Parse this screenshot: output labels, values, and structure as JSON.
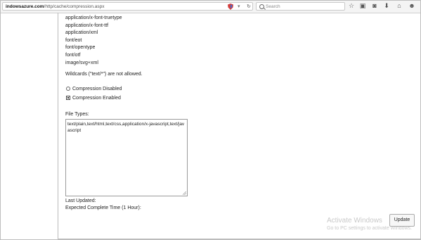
{
  "browser": {
    "url_host": "indowsazure.com",
    "url_path": "/http/cache/compression.aspx",
    "search_placeholder": "Search",
    "icons": [
      "shield-icon",
      "dropdown-arrow-icon",
      "reload-icon",
      "search-icon",
      "star-icon",
      "clipboard-icon",
      "pocket-icon",
      "download-icon",
      "home-icon",
      "menu-icon"
    ]
  },
  "mime_types": [
    "application/x-font-truetype",
    "application/x-font-ttf",
    "application/xml",
    "font/eot",
    "font/opentype",
    "font/otf",
    "image/svg+xml"
  ],
  "wildcards_note": "Wildcards (\"text/*\") are not allowed.",
  "compression": {
    "disabled_label": "Compression Disabled",
    "enabled_label": "Compression Enabled",
    "selected": "enabled"
  },
  "file_types": {
    "label": "File Types:",
    "value": "text/plain,text/html,text/css,application/x-javascript,text/javascript"
  },
  "last_updated_label": "Last Updated:",
  "expected_time_label": "Expected Complete Time (1 Hour):",
  "update_button": "Update",
  "watermark": {
    "title": "Activate Windows",
    "subtitle": "Go to PC settings to activate Windows."
  }
}
